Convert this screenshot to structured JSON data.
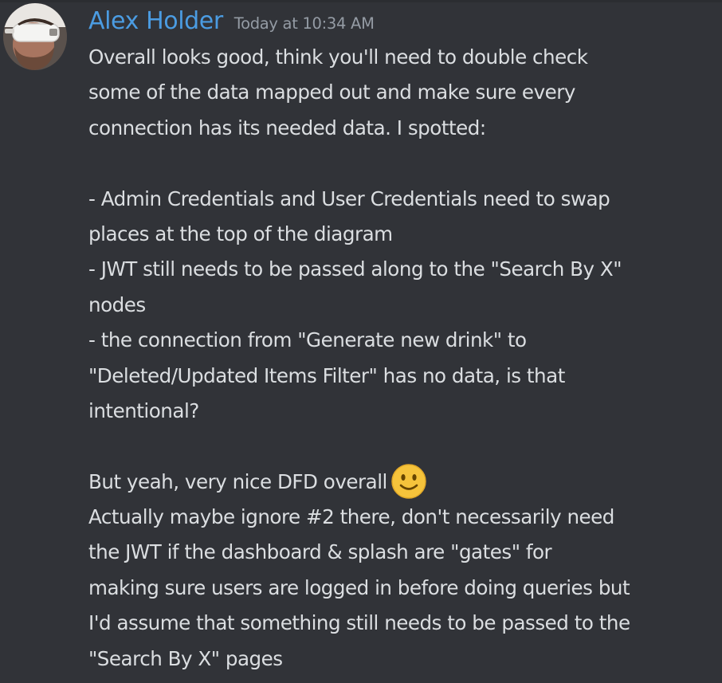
{
  "message": {
    "author": "Alex Holder",
    "timestamp": "Today at 10:34 AM",
    "author_color": "#4b9ce2",
    "avatar_icon": "user-avatar-vr-headset",
    "lines": [
      "Overall looks good, think you'll need to double check",
      "some of the data mapped out and make sure every",
      "connection has its needed data. I spotted:",
      "",
      "- Admin Credentials and User Credentials need to swap",
      "places at the top of the diagram",
      "- JWT still needs to be passed along to the \"Search By X\"",
      "nodes",
      "- the connection from \"Generate new drink\" to",
      "\"Deleted/Updated Items Filter\" has no data, is that",
      "intentional?",
      "",
      "But yeah, very nice DFD overall",
      "Actually maybe ignore #2 there, don't necessarily need",
      "the JWT if the dashboard & splash are \"gates\" for",
      "making sure users are logged in before doing queries but",
      "I'd assume that something still needs to be passed to the",
      "\"Search By X\" pages"
    ],
    "emoji_icon": "slightly-smiling-face-emoji"
  },
  "colors": {
    "background": "#313338",
    "text": "#dbdee1",
    "timestamp": "#949ba4"
  }
}
